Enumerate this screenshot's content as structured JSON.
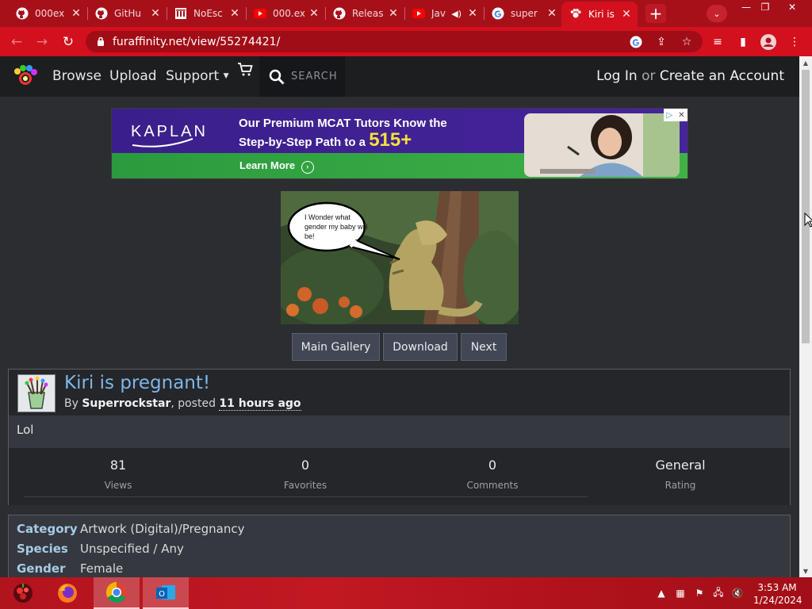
{
  "browser": {
    "tabs": [
      {
        "title": "000ex",
        "icon": "github-icon"
      },
      {
        "title": "GitHu",
        "icon": "github-icon"
      },
      {
        "title": "NoEsc",
        "icon": "institution-icon"
      },
      {
        "title": "000.ex",
        "icon": "youtube-icon"
      },
      {
        "title": "Releas",
        "icon": "github-icon"
      },
      {
        "title": "Jav",
        "icon": "youtube-icon"
      },
      {
        "title": "super",
        "icon": "google-icon"
      },
      {
        "title": "Kiri is",
        "icon": "furaffinity-icon",
        "active": true
      }
    ],
    "url": "furaffinity.net/view/55274421/",
    "accent": "#d3101e"
  },
  "site": {
    "nav": {
      "browse": "Browse",
      "upload": "Upload",
      "support": "Support",
      "search_placeholder": "SEARCH",
      "login": "Log In",
      "or": "or",
      "create_account": "Create an Account"
    },
    "ad": {
      "brand": "KAPLAN",
      "headline_line1": "Our Premium MCAT Tutors Know the",
      "headline_line2": "Step-by-Step Path to a",
      "headline_number": "515+",
      "cta": "Learn More"
    },
    "artwork": {
      "speech": "I Wonder what gender my baby will be!"
    },
    "buttons": {
      "main_gallery": "Main Gallery",
      "download": "Download",
      "next": "Next"
    },
    "submission": {
      "title": "Kiri is pregnant!",
      "by": "By",
      "author": "Superrockstar",
      "posted": ", posted",
      "time": "11 hours ago",
      "description": "Lol",
      "stats": [
        {
          "value": "81",
          "label": "Views"
        },
        {
          "value": "0",
          "label": "Favorites"
        },
        {
          "value": "0",
          "label": "Comments"
        },
        {
          "value": "General",
          "label": "Rating"
        }
      ]
    },
    "details": [
      {
        "key": "Category",
        "value": "Artwork (Digital)/Pregnancy"
      },
      {
        "key": "Species",
        "value": "Unspecified / Any"
      },
      {
        "key": "Gender",
        "value": "Female"
      }
    ]
  },
  "taskbar": {
    "time": "3:53 AM",
    "date": "1/24/2024"
  }
}
